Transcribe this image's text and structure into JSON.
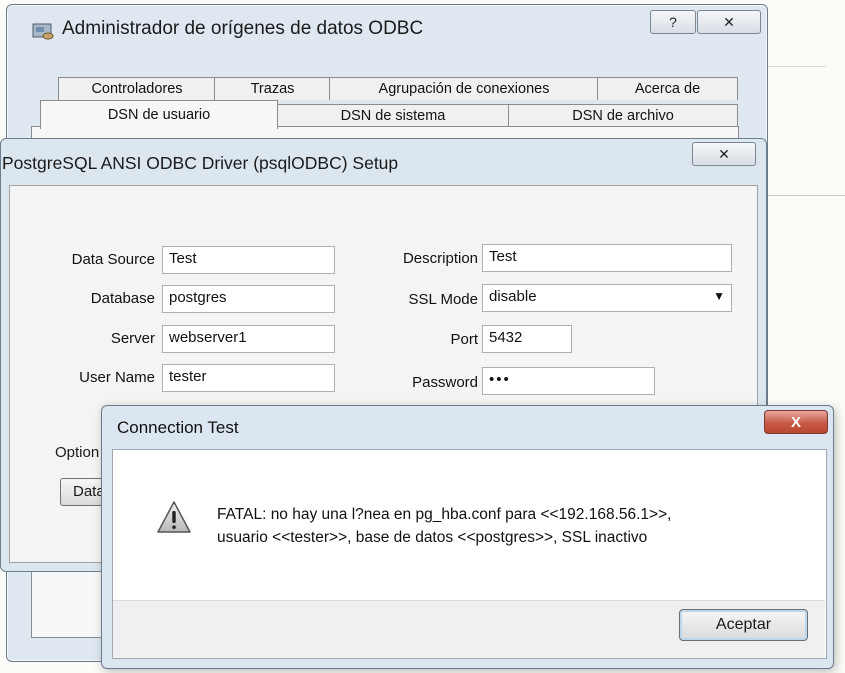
{
  "admin_window": {
    "title": "Administrador de orígenes de datos ODBC",
    "help_button": "?",
    "close_button": "✕",
    "tabs_row1": [
      "Controladores",
      "Trazas",
      "Agrupación de conexiones",
      "Acerca de"
    ],
    "tabs_row2": [
      "DSN de usuario",
      "DSN de sistema",
      "DSN de archivo"
    ]
  },
  "setup_dialog": {
    "title": "PostgreSQL ANSI ODBC Driver (psqlODBC) Setup",
    "close_button": "✕",
    "fields": {
      "data_source_label": "Data Source",
      "data_source_value": "Test",
      "database_label": "Database",
      "database_value": "postgres",
      "server_label": "Server",
      "server_value": "webserver1",
      "username_label": "User Name",
      "username_value": "tester",
      "description_label": "Description",
      "description_value": "Test",
      "ssl_mode_label": "SSL Mode",
      "ssl_mode_value": "disable",
      "port_label": "Port",
      "port_value": "5432",
      "password_label": "Password",
      "password_value": "•••"
    },
    "options_label": "Option",
    "datasource_button": "Data"
  },
  "connection_test": {
    "title": "Connection Test",
    "close_button": "X",
    "message_line1": "FATAL: no hay una l?nea en pg_hba.conf para <<192.168.56.1>>,",
    "message_line2": "usuario <<tester>>, base de datos <<postgres>>, SSL inactivo",
    "ok_button": "Aceptar",
    "icon": "warning-icon"
  },
  "colors": {
    "window_frame": "#dce6ef",
    "close_red": "#c75a47"
  }
}
